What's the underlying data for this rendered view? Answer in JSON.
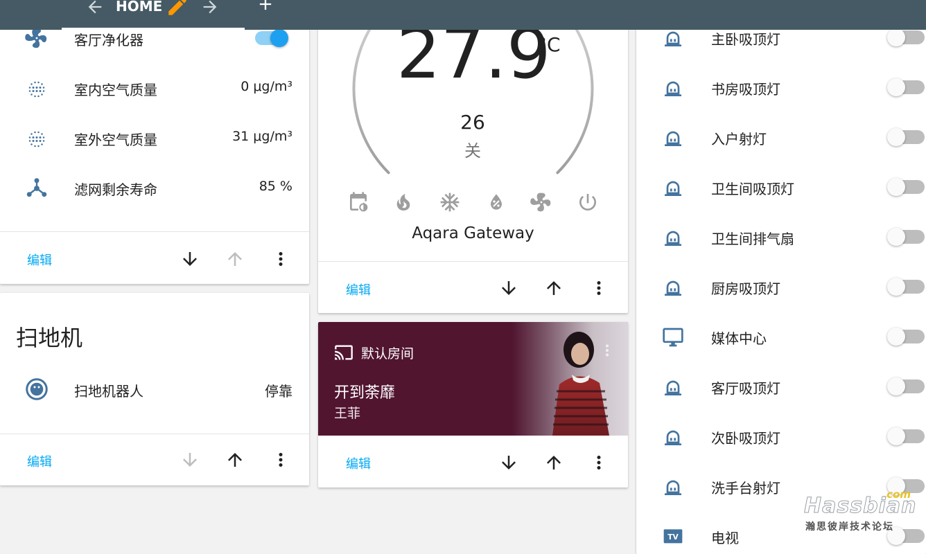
{
  "header": {
    "tab_title": "HOME"
  },
  "purifier_card": {
    "rows": [
      {
        "label": "客厅净化器",
        "icon": "fan-icon",
        "toggle_on": true
      },
      {
        "label": "室内空气质量",
        "value": "0 μg/m³",
        "icon": "air-quality-icon"
      },
      {
        "label": "室外空气质量",
        "value": "31 μg/m³",
        "icon": "air-quality-icon"
      },
      {
        "label": "滤网剩余寿命",
        "value": "85 %",
        "icon": "filter-icon"
      }
    ],
    "edit_label": "编辑"
  },
  "vacuum_card": {
    "title": "扫地机",
    "row": {
      "label": "扫地机器人",
      "value": "停靠",
      "icon": "robot-vacuum-icon"
    },
    "edit_label": "编辑"
  },
  "thermostat_card": {
    "current_temp": "27.9",
    "unit": "°C",
    "target_temp": "26",
    "state": "关",
    "name": "Aqara Gateway",
    "modes": [
      "schedule-icon",
      "heat-icon",
      "cool-icon",
      "dry-icon",
      "fan-icon",
      "power-icon"
    ],
    "edit_label": "编辑"
  },
  "media_card": {
    "source": "默认房间",
    "title": "开到荼靡",
    "artist": "王菲",
    "background_color": "#511530",
    "edit_label": "编辑"
  },
  "lights_card": {
    "items": [
      {
        "label": "主卧吸顶灯",
        "icon": "ceiling-light-icon"
      },
      {
        "label": "书房吸顶灯",
        "icon": "ceiling-light-icon"
      },
      {
        "label": "入户射灯",
        "icon": "ceiling-light-icon"
      },
      {
        "label": "卫生间吸顶灯",
        "icon": "ceiling-light-icon"
      },
      {
        "label": "卫生间排气扇",
        "icon": "ceiling-light-icon"
      },
      {
        "label": "厨房吸顶灯",
        "icon": "ceiling-light-icon"
      },
      {
        "label": "媒体中心",
        "icon": "monitor-icon"
      },
      {
        "label": "客厅吸顶灯",
        "icon": "ceiling-light-icon"
      },
      {
        "label": "次卧吸顶灯",
        "icon": "ceiling-light-icon"
      },
      {
        "label": "洗手台射灯",
        "icon": "ceiling-light-icon"
      },
      {
        "label": "电视",
        "icon": "tv-icon"
      }
    ]
  },
  "watermark": {
    "brand": "Hassbian",
    "domain": ".com",
    "subtitle": "瀚思彼岸技术论坛"
  },
  "colors": {
    "header": "#455a64",
    "accent": "#03a9f4",
    "icon": "#44739e",
    "toggle_on": "#1ea0f0"
  }
}
